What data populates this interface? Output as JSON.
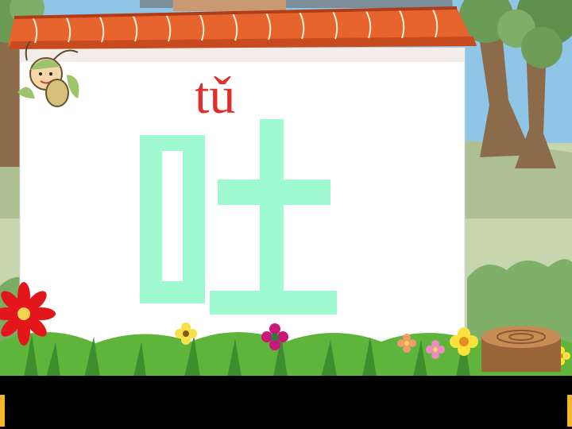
{
  "lesson": {
    "pinyin": "tǔ",
    "character": "吐"
  },
  "colors": {
    "sky": "#8fc6e8",
    "board": "#ffffff",
    "pinyin": "#e0302d",
    "character": "#9ffacf",
    "roof": "#e8642e",
    "grass": "#5fb43c",
    "bottom_bar": "#000000"
  },
  "icons": {
    "mascot": "cartoon-bug-icon",
    "flowers": "flower-icon",
    "stump": "tree-stump-icon"
  }
}
